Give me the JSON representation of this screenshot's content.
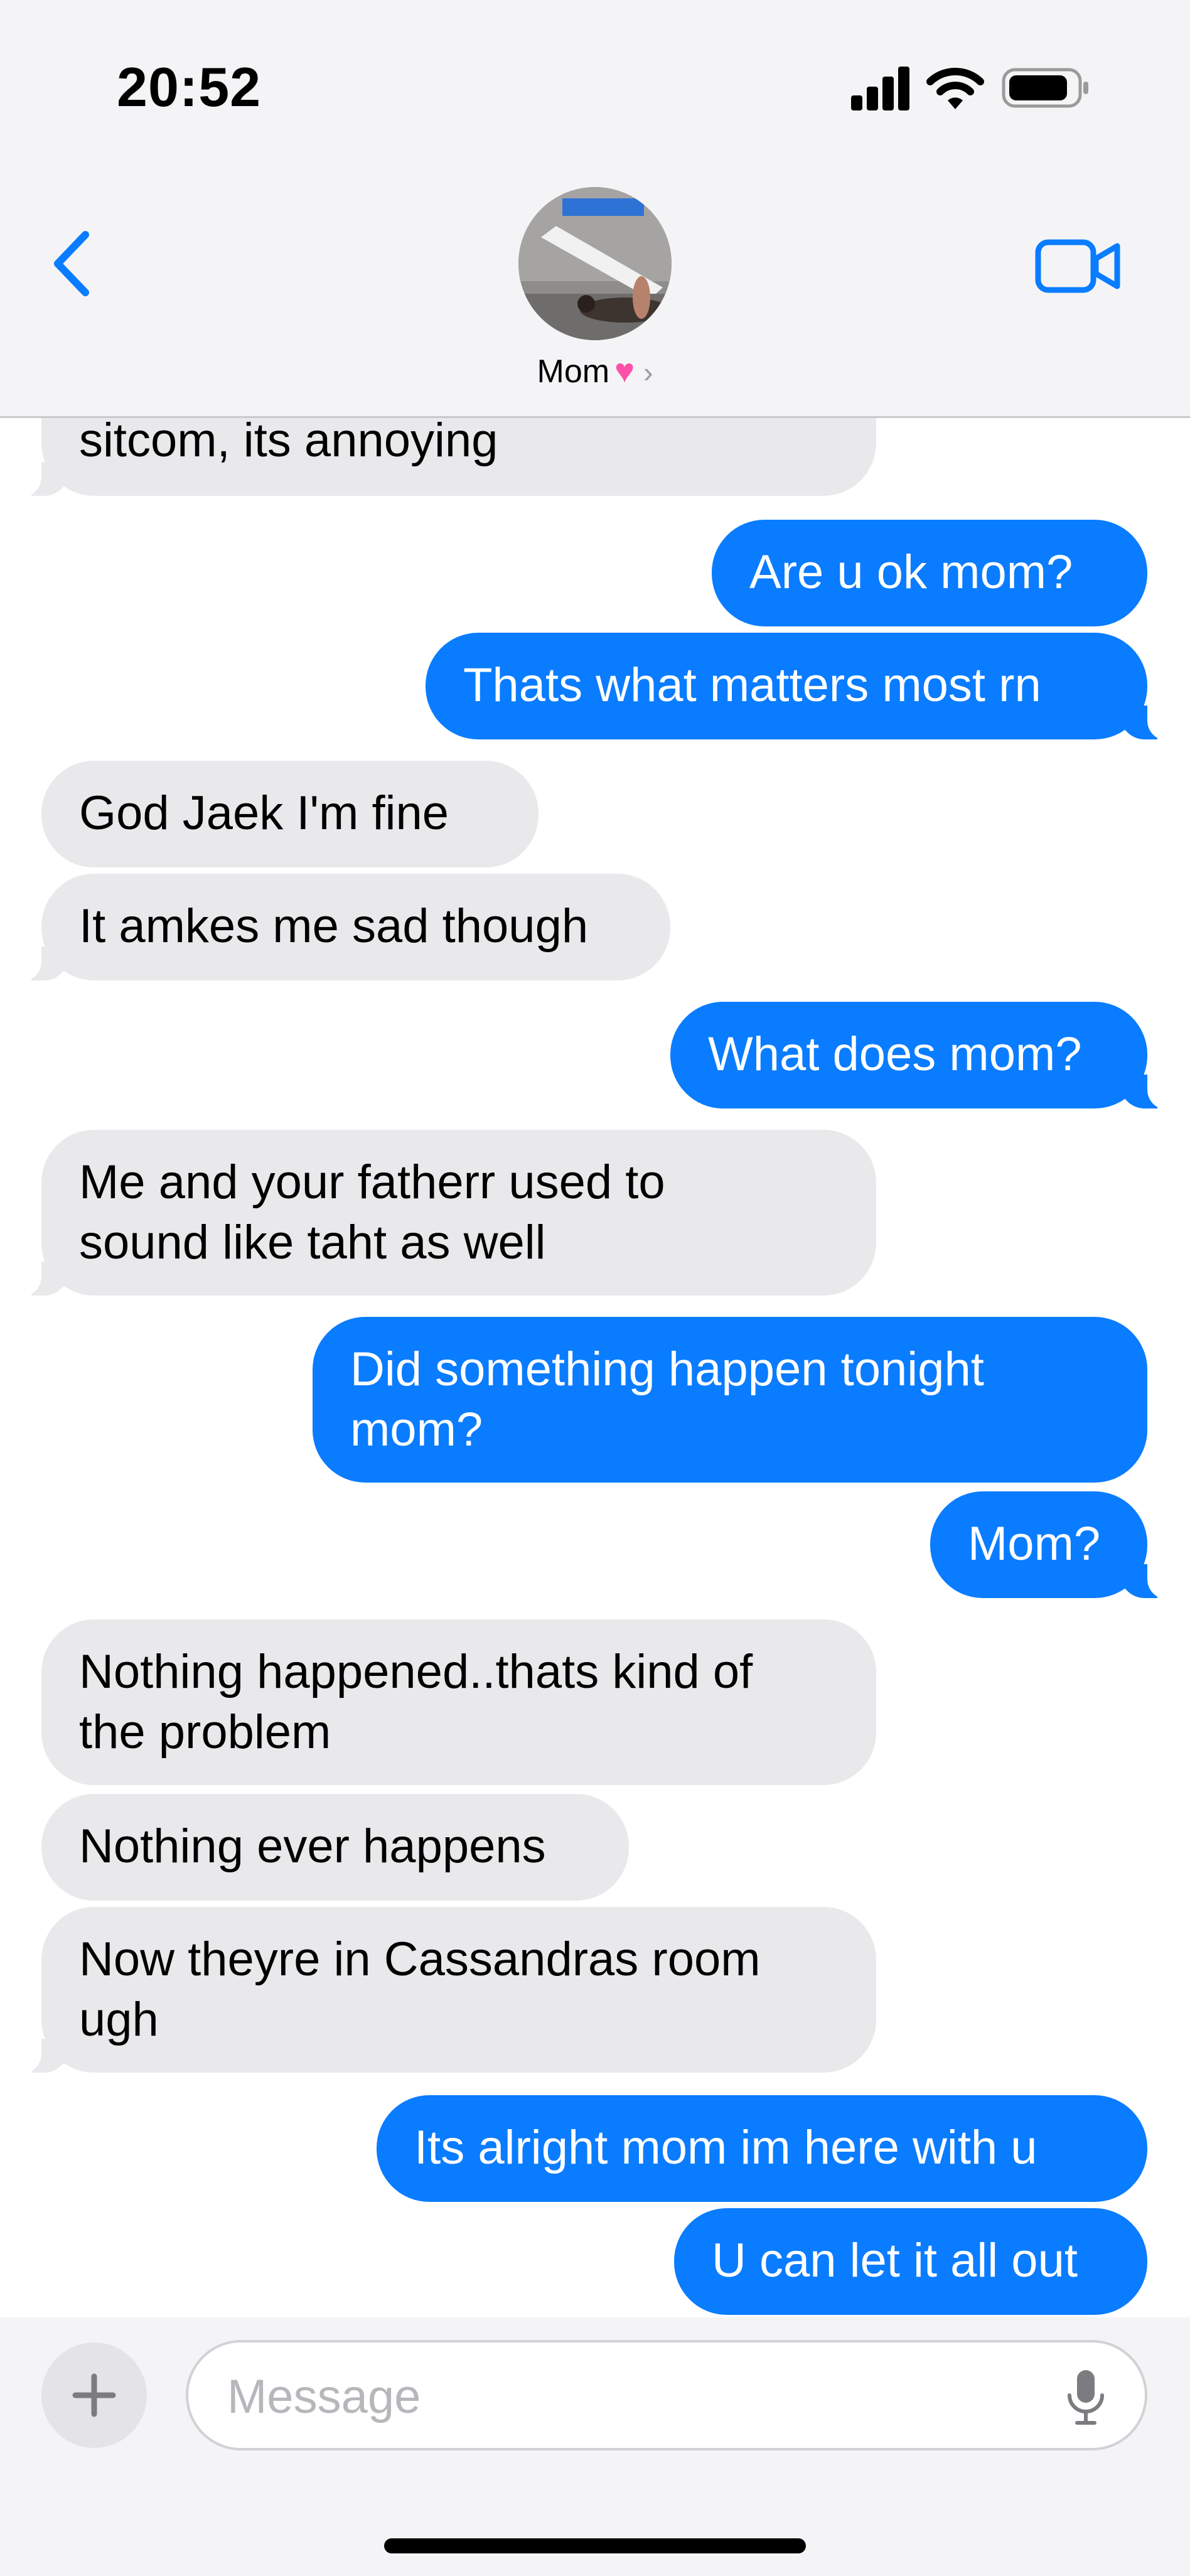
{
  "status_bar": {
    "time": "20:52"
  },
  "header": {
    "contact_name": "Mom",
    "heart_glyph": "♥",
    "chevron_glyph": "›"
  },
  "messages": [
    {
      "direction": "in",
      "text": "sitcom, its annoying"
    },
    {
      "direction": "out",
      "text": "Are u ok mom?"
    },
    {
      "direction": "out",
      "text": "Thats what matters most rn"
    },
    {
      "direction": "in",
      "text": "God Jaek I'm fine"
    },
    {
      "direction": "in",
      "text": "It amkes me sad though"
    },
    {
      "direction": "out",
      "text": "What does mom?"
    },
    {
      "direction": "in",
      "lines": [
        "Me and your fatherr used to",
        "sound like taht as well"
      ]
    },
    {
      "direction": "out",
      "lines": [
        "Did something happen tonight",
        "mom?"
      ]
    },
    {
      "direction": "out",
      "text": "Mom?"
    },
    {
      "direction": "in",
      "lines": [
        "Nothing happened..thats kind of",
        "the problem"
      ]
    },
    {
      "direction": "in",
      "text": "Nothing ever happens"
    },
    {
      "direction": "in",
      "lines": [
        "Now theyre in Cassandras room",
        "ugh"
      ]
    },
    {
      "direction": "out",
      "text": "Its alright mom im here with u"
    },
    {
      "direction": "out",
      "text": "U can let it all out"
    }
  ],
  "input_bar": {
    "placeholder": "Message",
    "plus_glyph": "+"
  },
  "colors": {
    "outgoing_bubble": "#0a7cff",
    "incoming_bubble": "#e9e9eb",
    "accent": "#0a7cff"
  }
}
